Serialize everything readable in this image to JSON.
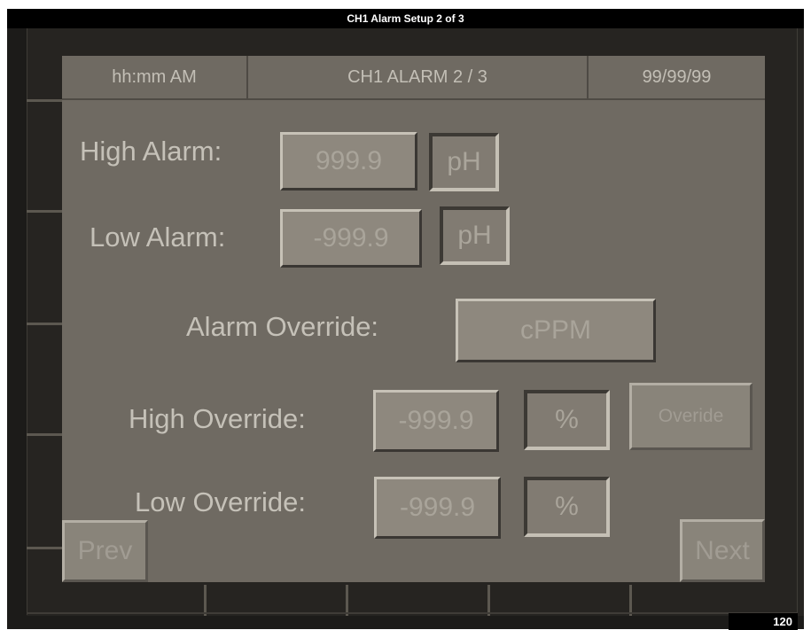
{
  "window": {
    "title": "CH1 Alarm Setup 2 of 3"
  },
  "header": {
    "time": "hh:mm AM",
    "screen_title": "CH1 ALARM 2 / 3",
    "date": "99/99/99"
  },
  "high_alarm": {
    "label": "High Alarm:",
    "value": "999.9",
    "unit": "pH"
  },
  "low_alarm": {
    "label": "Low Alarm:",
    "value": "-999.9",
    "unit": "pH"
  },
  "alarm_override": {
    "label": "Alarm Override:",
    "value": "cPPM"
  },
  "high_override": {
    "label": "High Override:",
    "value": "-999.9",
    "unit": "%"
  },
  "low_override": {
    "label": "Low Override:",
    "value": "-999.9",
    "unit": "%"
  },
  "buttons": {
    "override": "Overide",
    "prev": "Prev",
    "next": "Next"
  },
  "status": {
    "counter": "120"
  }
}
